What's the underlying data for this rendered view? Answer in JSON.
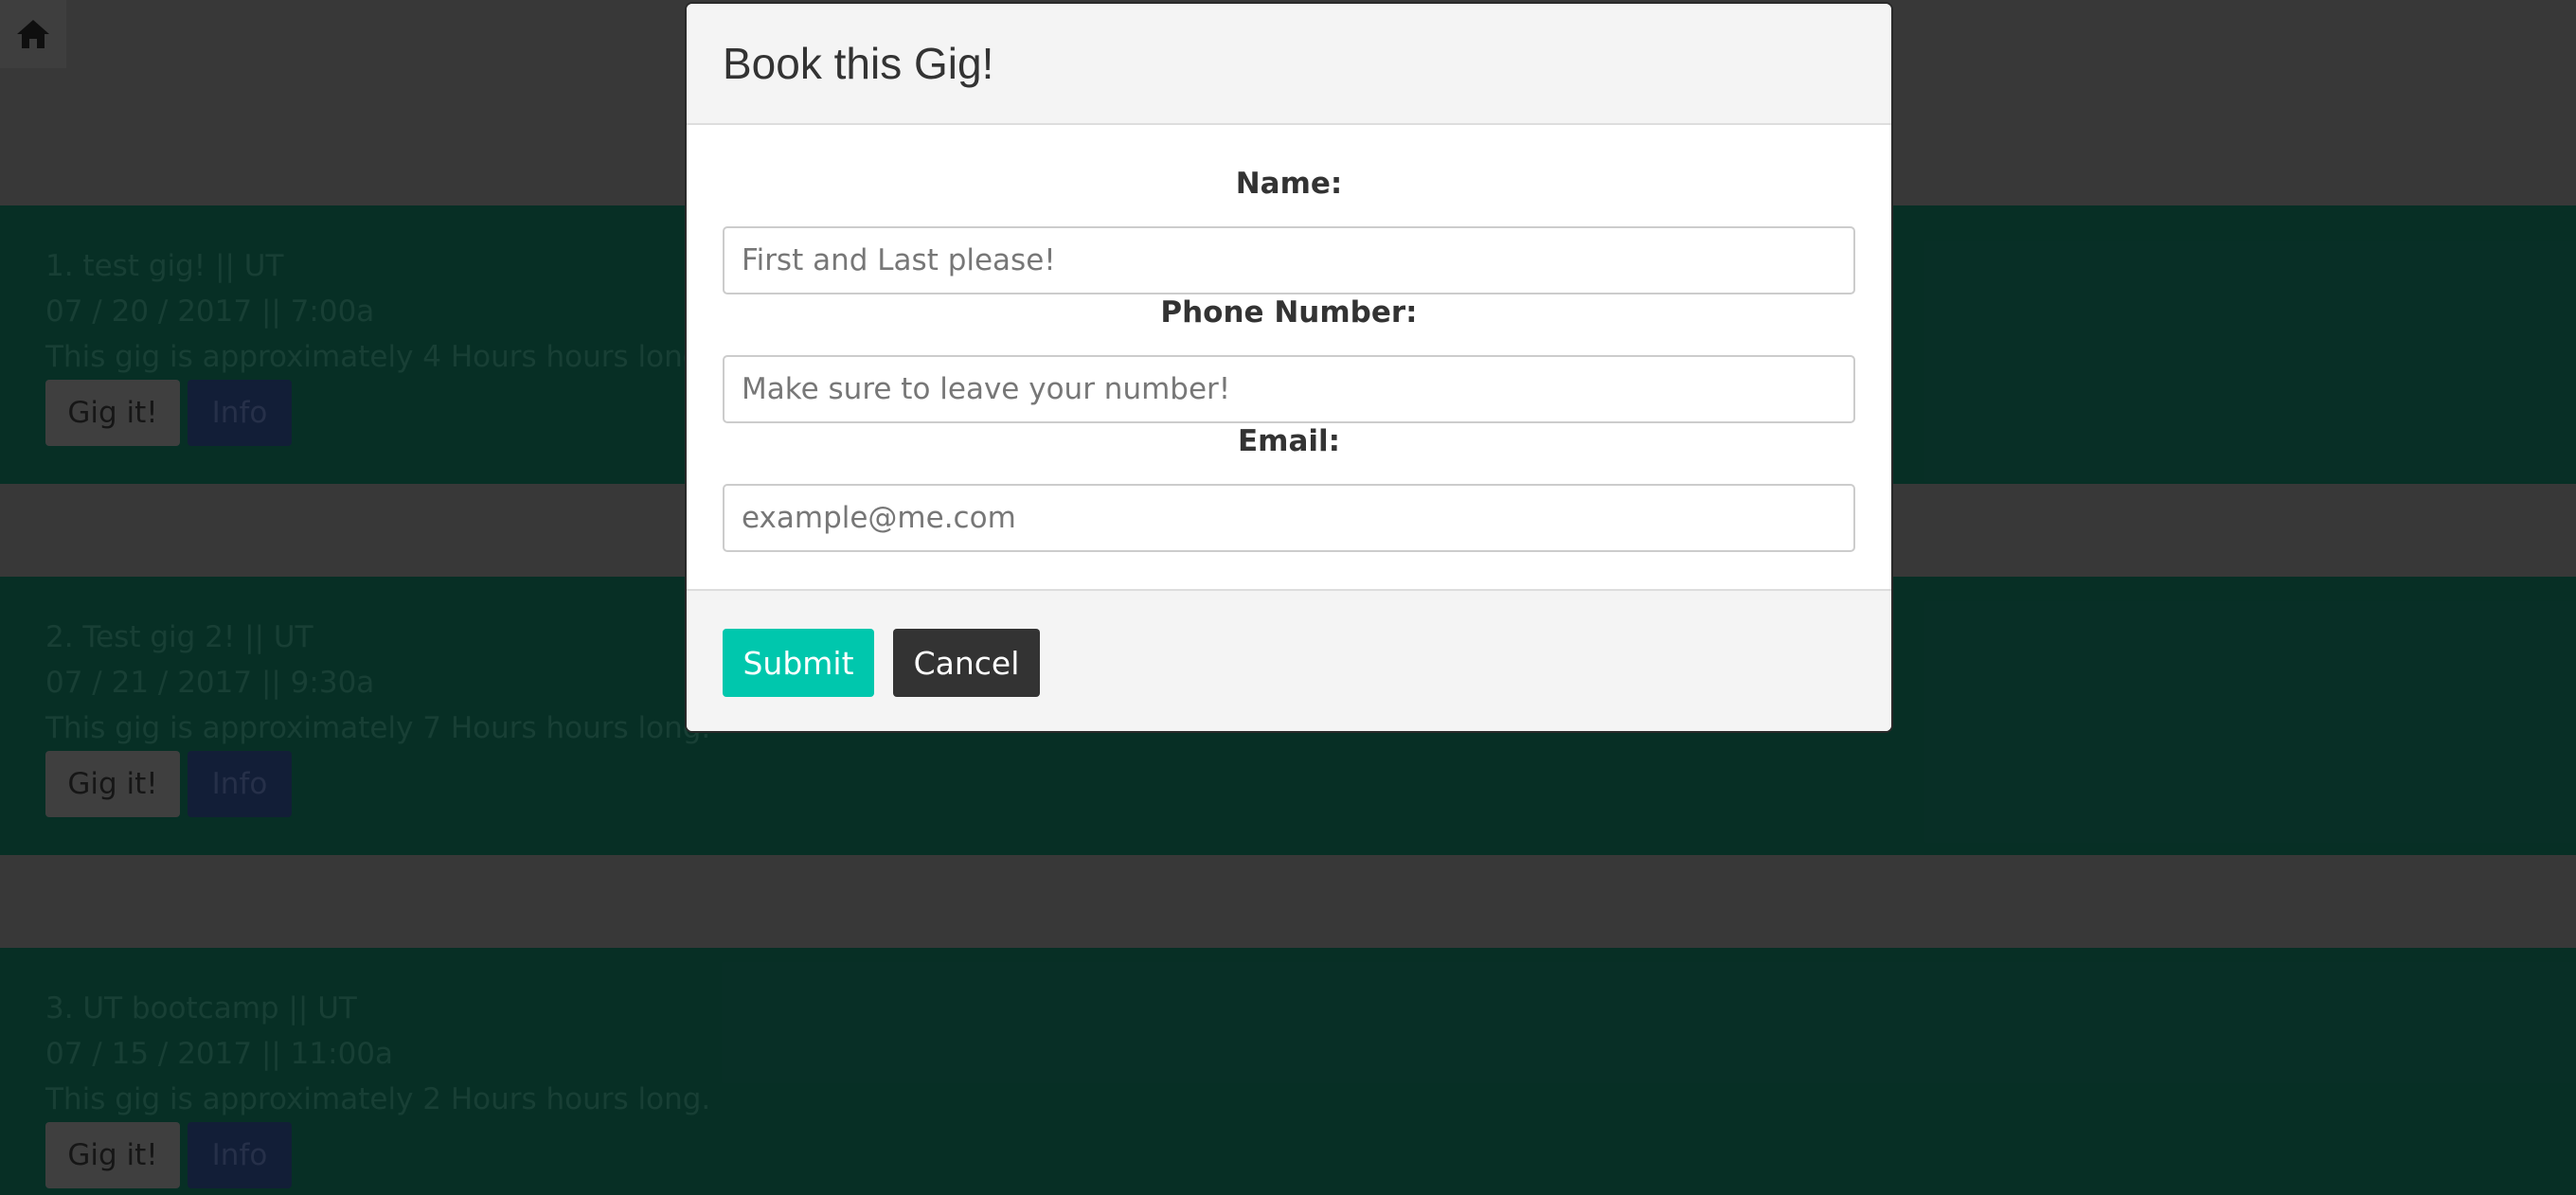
{
  "background": {
    "home_icon": "home-icon",
    "gigs": [
      {
        "title": "1. test gig! || UT",
        "datetime": "07 / 20 / 2017 || 7:00a",
        "duration": "This gig is approximately 4 Hours hours long.",
        "gig_button": "Gig it!",
        "info_button": "Info"
      },
      {
        "title": "2. Test gig 2! || UT",
        "datetime": "07 / 21 / 2017 || 9:30a",
        "duration": "This gig is approximately 7 Hours hours long.",
        "gig_button": "Gig it!",
        "info_button": "Info"
      },
      {
        "title": "3. UT bootcamp || UT",
        "datetime": "07 / 15 / 2017 || 11:00a",
        "duration": "This gig is approximately 2 Hours hours long.",
        "gig_button": "Gig it!",
        "info_button": "Info"
      }
    ]
  },
  "modal": {
    "title": "Book this Gig!",
    "fields": {
      "name": {
        "label": "Name:",
        "placeholder": "First and Last please!",
        "value": ""
      },
      "phone": {
        "label": "Phone Number:",
        "placeholder": "Make sure to leave your number!",
        "value": ""
      },
      "email": {
        "label": "Email:",
        "placeholder": "example@me.com",
        "value": ""
      }
    },
    "submit_label": "Submit",
    "cancel_label": "Cancel"
  },
  "colors": {
    "card_green": "#0f5b48",
    "submit_teal": "#00c7ad",
    "cancel_dark": "#333333",
    "info_blue": "#233a6a"
  }
}
